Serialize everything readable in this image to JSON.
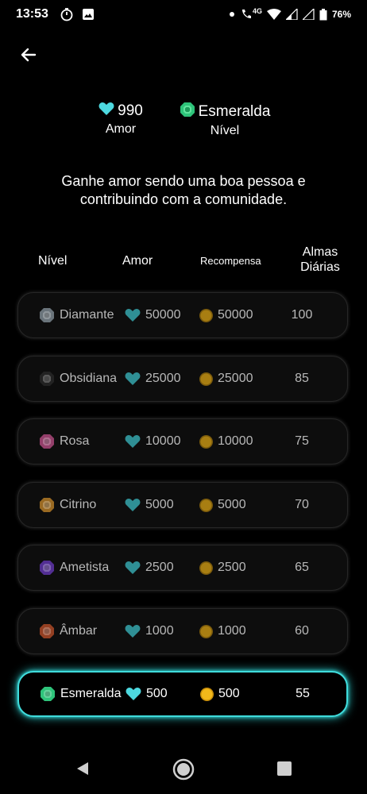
{
  "status_bar": {
    "time": "13:53",
    "network": "4G",
    "battery": "76%"
  },
  "summary": {
    "love_value": "990",
    "love_label": "Amor",
    "level_value": "Esmeralda",
    "level_label": "Nível"
  },
  "intro_text": "Ganhe amor sendo uma boa pessoa e contribuindo com a comunidade.",
  "table": {
    "headers": {
      "level": "Nível",
      "love": "Amor",
      "reward": "Recompensa",
      "souls_line1": "Almas",
      "souls_line2": "Diárias"
    },
    "rows": [
      {
        "level": "Diamante",
        "love": "50000",
        "reward": "50000",
        "souls": "100",
        "gem_color": "#8a97a0"
      },
      {
        "level": "Obsidiana",
        "love": "25000",
        "reward": "25000",
        "souls": "85",
        "gem_color": "#2a2a2a"
      },
      {
        "level": "Rosa",
        "love": "10000",
        "reward": "10000",
        "souls": "75",
        "gem_color": "#c0508a"
      },
      {
        "level": "Citrino",
        "love": "5000",
        "reward": "5000",
        "souls": "70",
        "gem_color": "#c98a2a"
      },
      {
        "level": "Ametista",
        "love": "2500",
        "reward": "2500",
        "souls": "65",
        "gem_color": "#6a3ac0"
      },
      {
        "level": "Âmbar",
        "love": "1000",
        "reward": "1000",
        "souls": "60",
        "gem_color": "#c0502a"
      },
      {
        "level": "Esmeralda",
        "love": "500",
        "reward": "500",
        "souls": "55",
        "gem_color": "#2ec37a",
        "current": true
      }
    ]
  },
  "colors": {
    "heart": "#4dd9e0",
    "heart_dim": "#2f8f95",
    "coin": "#f2b81a",
    "coin_dim": "#a87e12",
    "accent": "#3fdcdc"
  }
}
